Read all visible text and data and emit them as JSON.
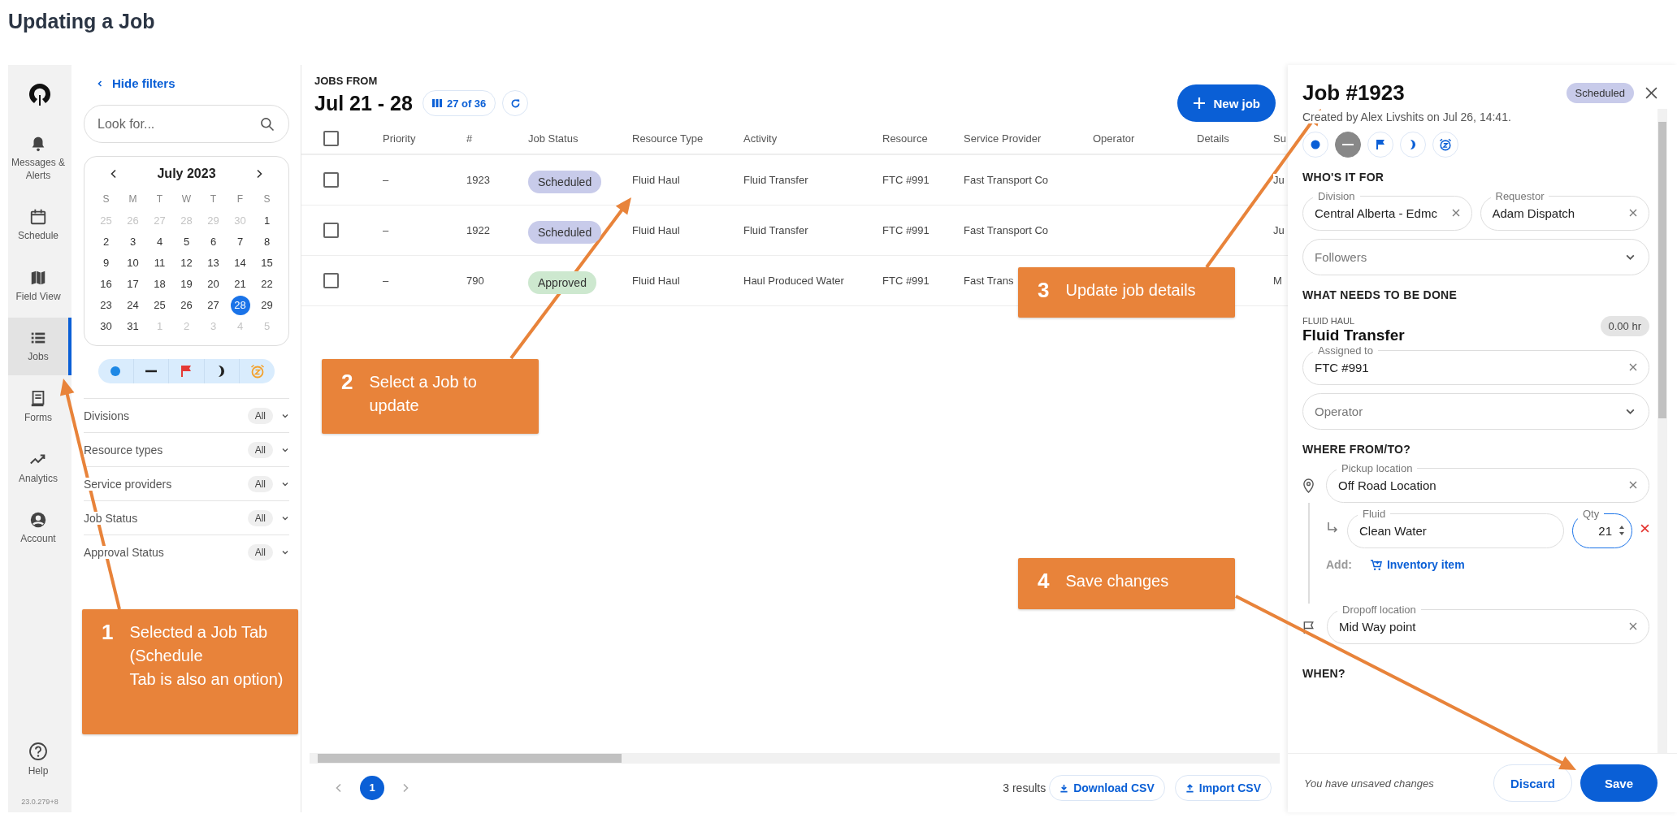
{
  "page_title": "Updating a Job",
  "nav": {
    "items": [
      {
        "label": "Messages & Alerts",
        "kind": "bell",
        "selected": false
      },
      {
        "label": "Schedule",
        "kind": "calendar",
        "selected": false
      },
      {
        "label": "Field View",
        "kind": "map",
        "selected": false
      },
      {
        "label": "Jobs",
        "kind": "list",
        "selected": true
      },
      {
        "label": "Forms",
        "kind": "form",
        "selected": false
      },
      {
        "label": "Analytics",
        "kind": "trend",
        "selected": false
      },
      {
        "label": "Account",
        "kind": "account",
        "selected": false
      }
    ],
    "help": "Help",
    "version": "23.0.279+8"
  },
  "filters": {
    "hide_link": "Hide filters",
    "search": {
      "placeholder": "Look for..."
    },
    "calendar": {
      "month": "July 2023",
      "weekdays": [
        "S",
        "M",
        "T",
        "W",
        "T",
        "F",
        "S"
      ],
      "weeks": [
        {
          "days": [
            {
              "day": "25",
              "muted": true,
              "selected": false
            },
            {
              "day": "26",
              "muted": true,
              "selected": false
            },
            {
              "day": "27",
              "muted": true,
              "selected": false
            },
            {
              "day": "28",
              "muted": true,
              "selected": false
            },
            {
              "day": "29",
              "muted": true,
              "selected": false
            },
            {
              "day": "30",
              "muted": true,
              "selected": false
            },
            {
              "day": "1",
              "muted": false,
              "selected": false
            }
          ]
        },
        {
          "days": [
            {
              "day": "2",
              "muted": false,
              "selected": false
            },
            {
              "day": "3",
              "muted": false,
              "selected": false
            },
            {
              "day": "4",
              "muted": false,
              "selected": false
            },
            {
              "day": "5",
              "muted": false,
              "selected": false
            },
            {
              "day": "6",
              "muted": false,
              "selected": false
            },
            {
              "day": "7",
              "muted": false,
              "selected": false
            },
            {
              "day": "8",
              "muted": false,
              "selected": false
            }
          ]
        },
        {
          "days": [
            {
              "day": "9",
              "muted": false,
              "selected": false
            },
            {
              "day": "10",
              "muted": false,
              "selected": false
            },
            {
              "day": "11",
              "muted": false,
              "selected": false
            },
            {
              "day": "12",
              "muted": false,
              "selected": false
            },
            {
              "day": "13",
              "muted": false,
              "selected": false
            },
            {
              "day": "14",
              "muted": false,
              "selected": false
            },
            {
              "day": "15",
              "muted": false,
              "selected": false
            }
          ]
        },
        {
          "days": [
            {
              "day": "16",
              "muted": false,
              "selected": false
            },
            {
              "day": "17",
              "muted": false,
              "selected": false
            },
            {
              "day": "18",
              "muted": false,
              "selected": false
            },
            {
              "day": "19",
              "muted": false,
              "selected": false
            },
            {
              "day": "20",
              "muted": false,
              "selected": false
            },
            {
              "day": "21",
              "muted": false,
              "selected": false
            },
            {
              "day": "22",
              "muted": false,
              "selected": false
            }
          ]
        },
        {
          "days": [
            {
              "day": "23",
              "muted": false,
              "selected": false
            },
            {
              "day": "24",
              "muted": false,
              "selected": false
            },
            {
              "day": "25",
              "muted": false,
              "selected": false
            },
            {
              "day": "26",
              "muted": false,
              "selected": false
            },
            {
              "day": "27",
              "muted": false,
              "selected": false
            },
            {
              "day": "28",
              "muted": false,
              "selected": true
            },
            {
              "day": "29",
              "muted": false,
              "selected": false
            }
          ]
        },
        {
          "days": [
            {
              "day": "30",
              "muted": false,
              "selected": false
            },
            {
              "day": "31",
              "muted": false,
              "selected": false
            },
            {
              "day": "1",
              "muted": true,
              "selected": false
            },
            {
              "day": "2",
              "muted": true,
              "selected": false
            },
            {
              "day": "3",
              "muted": true,
              "selected": false
            },
            {
              "day": "4",
              "muted": true,
              "selected": false
            },
            {
              "day": "5",
              "muted": true,
              "selected": false
            }
          ]
        }
      ]
    },
    "groups": [
      {
        "label": "Divisions",
        "value": "All"
      },
      {
        "label": "Resource types",
        "value": "All"
      },
      {
        "label": "Service providers",
        "value": "All"
      },
      {
        "label": "Job Status",
        "value": "All"
      },
      {
        "label": "Approval Status",
        "value": "All"
      }
    ]
  },
  "jobs": {
    "caption": "JOBS FROM",
    "range": "Jul 21 - 28",
    "columns_chip": "27 of 36",
    "new_button": "New job",
    "select_all_checked": false,
    "columns": [
      "Priority",
      "#",
      "Job Status",
      "Resource Type",
      "Activity",
      "Resource",
      "Service Provider",
      "Operator",
      "Details",
      "Su"
    ],
    "rows": [
      {
        "checked": false,
        "priority": "–",
        "number": "1923",
        "status": {
          "label": "Scheduled",
          "color": "#c8cbea"
        },
        "resource_type": "Fluid Haul",
        "activity": "Fluid Transfer",
        "resource": "FTC #991",
        "service_provider": "Fast Transport Co",
        "column_10": "Ju"
      },
      {
        "checked": false,
        "priority": "–",
        "number": "1922",
        "status": {
          "label": "Scheduled",
          "color": "#c8cbea"
        },
        "resource_type": "Fluid Haul",
        "activity": "Fluid Transfer",
        "resource": "FTC #991",
        "service_provider": "Fast Transport Co",
        "column_10": "Ju"
      },
      {
        "checked": false,
        "priority": "–",
        "number": "790",
        "status": {
          "label": "Approved",
          "color": "#cde8cf"
        },
        "resource_type": "Fluid Haul",
        "activity": "Haul Produced Water",
        "resource": "FTC #991",
        "service_provider": "Fast Trans",
        "column_10": "M"
      }
    ]
  },
  "pagination": {
    "pages": [
      {
        "label": "1",
        "selected": true
      }
    ],
    "results": "3 results",
    "download": "Download CSV",
    "import": "Import CSV"
  },
  "job_panel": {
    "title": "Job #1923",
    "status": {
      "label": "Scheduled",
      "color": "#c8cbea"
    },
    "created": "Created by Alex Livshits on Jul 26, 14:41.",
    "priority_buttons": [
      {
        "kind": "dot",
        "selected": false
      },
      {
        "kind": "dash",
        "selected": true
      },
      {
        "kind": "flag",
        "selected": false
      },
      {
        "kind": "moon",
        "selected": false
      },
      {
        "kind": "alarm",
        "selected": false
      }
    ],
    "who": {
      "heading": "WHO'S IT FOR",
      "division": {
        "label": "Division",
        "value": "Central Alberta - Edmc"
      },
      "requestor": {
        "label": "Requestor",
        "value": "Adam Dispatch"
      },
      "followers": {
        "placeholder": "Followers"
      }
    },
    "what": {
      "heading": "WHAT NEEDS TO BE DONE",
      "resource_type": "FLUID HAUL",
      "activity": "Fluid Transfer",
      "duration": "0.00 hr",
      "assigned": {
        "label": "Assigned to",
        "value": "FTC #991"
      },
      "operator": {
        "placeholder": "Operator"
      }
    },
    "where": {
      "heading": "WHERE FROM/TO?",
      "pickup": {
        "label": "Pickup location",
        "value": "Off Road Location"
      },
      "fluid": {
        "label": "Fluid",
        "value": "Clean Water"
      },
      "qty": {
        "label": "Qty",
        "value": "21",
        "focused": true
      },
      "add_label": "Add:",
      "add_link": "Inventory item",
      "dropoff": {
        "label": "Dropoff location",
        "value": "Mid Way point"
      }
    },
    "when": {
      "heading": "WHEN?"
    },
    "footer": {
      "note": "You have unsaved changes",
      "discard": "Discard",
      "save": "Save"
    }
  },
  "callouts": [
    {
      "number": "1",
      "text": "Selected a Job Tab (Schedule\nTab is also an option)"
    },
    {
      "number": "2",
      "text": "Select a Job to update"
    },
    {
      "number": "3",
      "text": "Update job details"
    },
    {
      "number": "4",
      "text": "Save changes"
    }
  ]
}
